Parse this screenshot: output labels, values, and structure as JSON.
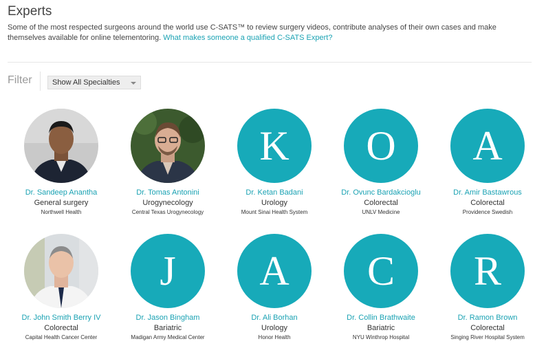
{
  "header": {
    "title": "Experts",
    "intro_text": "Some of the most respected surgeons around the world use C-SATS™ to review surgery videos, contribute analyses of their own cases and make themselves available for online telementoring. ",
    "intro_link": "What makes someone a qualified C-SATS Expert?"
  },
  "filter": {
    "label": "Filter",
    "selected": "Show All Specialties"
  },
  "experts": [
    {
      "name": "Dr. Sandeep Anantha",
      "specialty": "General surgery",
      "institution": "Northwell Health",
      "avatar": "photo",
      "initial": ""
    },
    {
      "name": "Dr. Tomas Antonini",
      "specialty": "Urogynecology",
      "institution": "Central Texas Urogynecology",
      "avatar": "photo",
      "initial": ""
    },
    {
      "name": "Dr. Ketan Badani",
      "specialty": "Urology",
      "institution": "Mount Sinai Health System",
      "avatar": "letter",
      "initial": "K"
    },
    {
      "name": "Dr. Ovunc Bardakcioglu",
      "specialty": "Colorectal",
      "institution": "UNLV Medicine",
      "avatar": "letter",
      "initial": "O"
    },
    {
      "name": "Dr. Amir Bastawrous",
      "specialty": "Colorectal",
      "institution": "Providence Swedish",
      "avatar": "letter",
      "initial": "A"
    },
    {
      "name": "Dr. John Smith Berry IV",
      "specialty": "Colorectal",
      "institution": "Capital Health Cancer Center",
      "avatar": "photo",
      "initial": ""
    },
    {
      "name": "Dr. Jason Bingham",
      "specialty": "Bariatric",
      "institution": "Madigan Army Medical Center",
      "avatar": "letter",
      "initial": "J"
    },
    {
      "name": "Dr. Ali Borhan",
      "specialty": "Urology",
      "institution": "Honor Health",
      "avatar": "letter",
      "initial": "A"
    },
    {
      "name": "Dr. Collin Brathwaite",
      "specialty": "Bariatric",
      "institution": "NYU Winthrop Hospital",
      "avatar": "letter",
      "initial": "C"
    },
    {
      "name": "Dr. Ramon Brown",
      "specialty": "Colorectal",
      "institution": "Singing River Hospital System",
      "avatar": "letter",
      "initial": "R"
    }
  ],
  "colors": {
    "accent": "#17aab9",
    "link": "#1aa2b3"
  }
}
